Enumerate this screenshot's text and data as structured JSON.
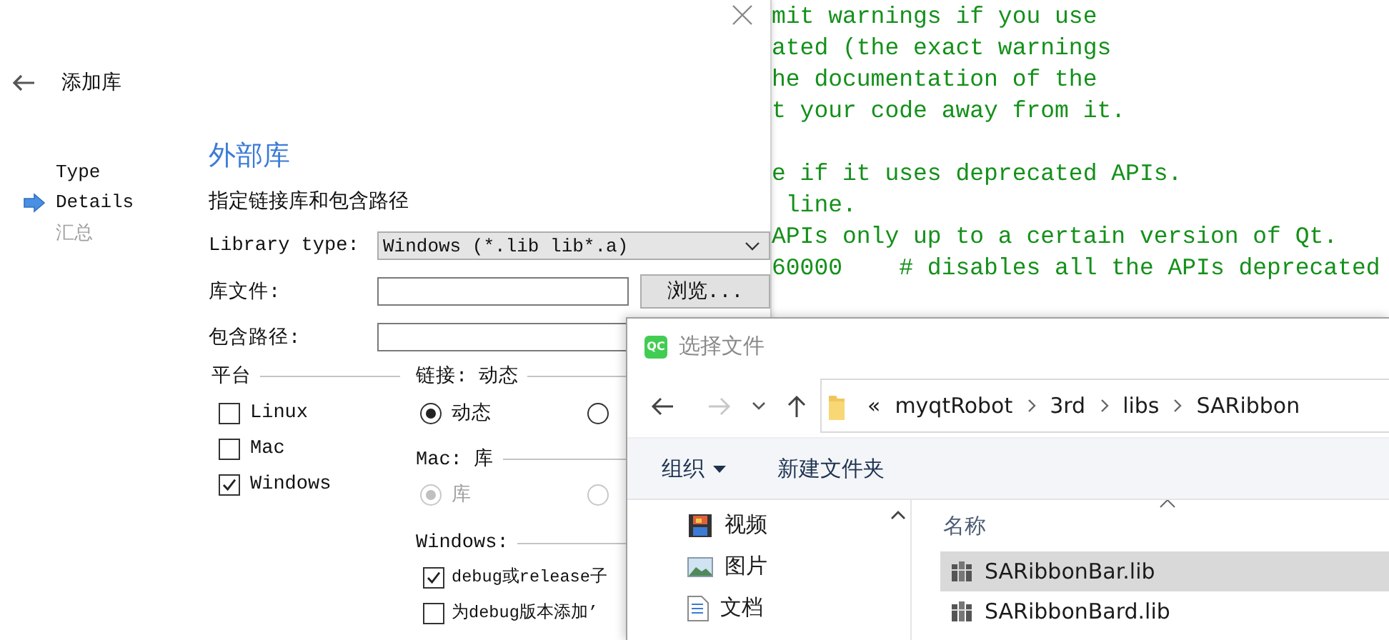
{
  "editor": {
    "lines": [
      {
        "kind": "code",
        "text": "mit warnings if you use"
      },
      {
        "kind": "code",
        "text": "ated (the exact warnings"
      },
      {
        "kind": "code",
        "text": "he documentation of the"
      },
      {
        "kind": "code",
        "text": "t your code away from it."
      },
      {
        "kind": "blank"
      },
      {
        "kind": "code",
        "text": "e if it uses deprecated APIs."
      },
      {
        "kind": "code",
        "text": " line."
      },
      {
        "kind": "code",
        "text": "APIs only up to a certain version of Qt."
      },
      {
        "kind": "code",
        "text": "60000    # disables all the APIs deprecated"
      }
    ]
  },
  "wizard": {
    "title": "添加库",
    "steps": [
      {
        "label": "Type",
        "selected": false,
        "disabled": false
      },
      {
        "label": "Details",
        "selected": true,
        "disabled": false
      },
      {
        "label": "汇总",
        "selected": false,
        "disabled": true
      }
    ],
    "heading": "外部库",
    "subtitle": "指定链接库和包含路径",
    "library_type": {
      "label": "Library type:",
      "value": "Windows (*.lib lib*.a)"
    },
    "library_file": {
      "label": "库文件:",
      "button": "浏览..."
    },
    "include_path": {
      "label": "包含路径:"
    },
    "platform": {
      "title": "平台",
      "options": [
        {
          "label": "Linux",
          "checked": false
        },
        {
          "label": "Mac",
          "checked": false
        },
        {
          "label": "Windows",
          "checked": true
        }
      ]
    },
    "linkage": {
      "title": "链接: 动态",
      "disabled": false,
      "options": [
        {
          "label": "动态",
          "selected": true
        },
        {
          "selected": false
        }
      ]
    },
    "mac": {
      "title": "Mac: 库",
      "disabled": true,
      "options": [
        {
          "label": "库",
          "selected": true
        },
        {
          "selected": false
        }
      ]
    },
    "windows": {
      "title": "Windows:",
      "options": [
        {
          "label": "debug或release子",
          "checked": true
        },
        {
          "label": "为debug版本添加’",
          "checked": false
        }
      ]
    }
  },
  "file_dialog": {
    "logo": "QC",
    "title": "选择文件",
    "path_overflow": "«",
    "path": [
      "myqtRobot",
      "3rd",
      "libs",
      "SARibbon"
    ],
    "toolbar": [
      {
        "label": "组织",
        "kind": "menu"
      },
      {
        "label": "新建文件夹",
        "kind": "button"
      }
    ],
    "nav_items": [
      {
        "label": "视频",
        "kind": "video"
      },
      {
        "label": "图片",
        "kind": "picture"
      },
      {
        "label": "文档",
        "kind": "document"
      }
    ],
    "column": "名称",
    "files": [
      {
        "name": "SARibbonBar.lib",
        "selected": true
      },
      {
        "name": "SARibbonBard.lib",
        "selected": false
      }
    ]
  }
}
